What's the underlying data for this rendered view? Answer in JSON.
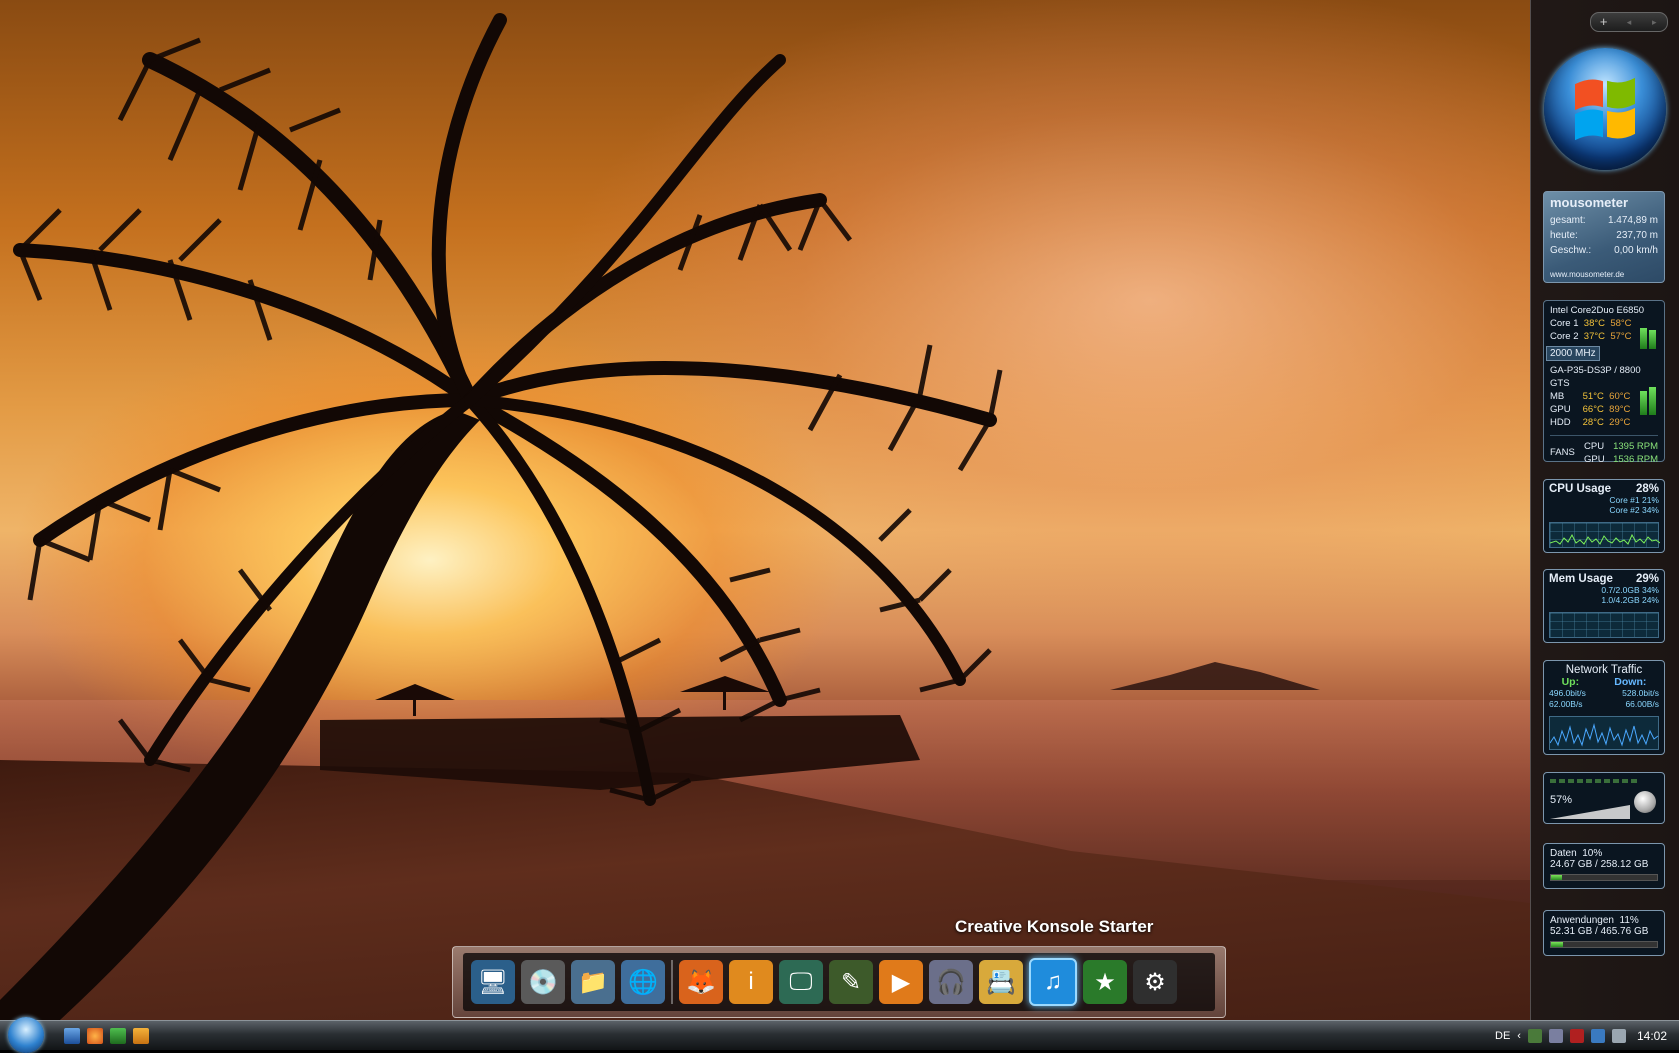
{
  "sidebar": {
    "controls": {
      "add": "+",
      "prev": "◂",
      "next": "▸"
    },
    "mousometer": {
      "title": "mousometer",
      "rows": [
        {
          "label": "gesamt:",
          "value": "1.474,89 m"
        },
        {
          "label": "heute:",
          "value": "237,70 m"
        },
        {
          "label": "Geschw.:",
          "value": "0,00 km/h"
        }
      ],
      "url": "www.mousometer.de"
    },
    "temps": {
      "cpu_name": "Intel Core2Duo E6850",
      "cores": [
        {
          "label": "Core 1",
          "cur": "38°C",
          "max": "58°C"
        },
        {
          "label": "Core 2",
          "cur": "37°C",
          "max": "57°C"
        }
      ],
      "mhz": "2000 MHz",
      "board": "GA-P35-DS3P / 8800 GTS",
      "sensors": [
        {
          "label": "MB",
          "cur": "51°C",
          "max": "60°C"
        },
        {
          "label": "GPU",
          "cur": "66°C",
          "max": "89°C"
        },
        {
          "label": "HDD",
          "cur": "28°C",
          "max": "29°C"
        }
      ],
      "fans_label": "FANS",
      "fans": [
        {
          "label": "CPU",
          "value": "1395 RPM"
        },
        {
          "label": "GPU",
          "value": "1536 RPM"
        }
      ]
    },
    "cpu_usage": {
      "title": "CPU Usage",
      "percent": "28%",
      "core1": "Core #1 21%",
      "core2": "Core #2 34%"
    },
    "mem_usage": {
      "title": "Mem Usage",
      "percent": "29%",
      "line1": "0.7/2.0GB 34%",
      "line2": "1.0/4.2GB 24%"
    },
    "network": {
      "title": "Network Traffic",
      "up_label": "Up:",
      "down_label": "Down:",
      "up_bits": "496.0bit/s",
      "down_bits": "528.0bit/s",
      "up_bytes": "62.00B/s",
      "down_bytes": "66.00B/s"
    },
    "volume": {
      "percent": "57%"
    },
    "disks": [
      {
        "name": "Daten",
        "percent": "10%",
        "size": "24.67 GB / 258.12 GB",
        "fill": 0.1
      },
      {
        "name": "Anwendungen",
        "percent": "11%",
        "size": "52.31 GB / 465.76 GB",
        "fill": 0.11
      }
    ]
  },
  "dock": {
    "hover_label": "Creative Konsole Starter",
    "icons": [
      {
        "name": "computer-icon",
        "glyph": "🖥",
        "bg": "#2b5f8a"
      },
      {
        "name": "drive-icon",
        "glyph": "💿",
        "bg": "#5a5a5a"
      },
      {
        "name": "documents-icon",
        "glyph": "📁",
        "bg": "#4a6f8f"
      },
      {
        "name": "network-icon",
        "glyph": "🌐",
        "bg": "#3f6e9c"
      },
      {
        "name": "firefox-icon",
        "glyph": "🦊",
        "bg": "#d9631c"
      },
      {
        "name": "info-icon",
        "glyph": "i",
        "bg": "#e08a1e"
      },
      {
        "name": "monitor-icon",
        "glyph": "🖵",
        "bg": "#2d6a54"
      },
      {
        "name": "app-icon",
        "glyph": "✎",
        "bg": "#3d5a2a"
      },
      {
        "name": "media-player-icon",
        "glyph": "▶",
        "bg": "#e07a1a"
      },
      {
        "name": "headphones-icon",
        "glyph": "🎧",
        "bg": "#6b6f8a"
      },
      {
        "name": "contacts-icon",
        "glyph": "📇",
        "bg": "#d8a93b"
      },
      {
        "name": "music-icon",
        "glyph": "♫",
        "bg": "#1f8cdc"
      },
      {
        "name": "star4-icon",
        "glyph": "★",
        "bg": "#2a7a2a"
      },
      {
        "name": "steam-icon",
        "glyph": "⚙",
        "bg": "#2f2f2f"
      }
    ]
  },
  "taskbar": {
    "language": "DE",
    "tray_arrow": "‹",
    "clock": "14:02"
  }
}
